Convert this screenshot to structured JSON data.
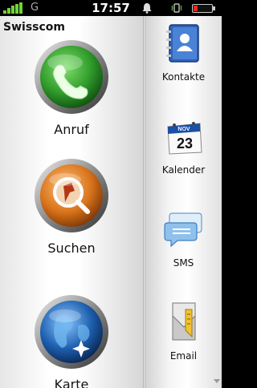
{
  "status_bar": {
    "network_type": "G",
    "time": "17:57"
  },
  "carrier": "Swisscom",
  "main_apps": [
    {
      "label": "Anruf",
      "icon": "phone-icon"
    },
    {
      "label": "Suchen",
      "icon": "search-icon"
    },
    {
      "label": "Karte",
      "icon": "map-globe-icon"
    }
  ],
  "side_apps": [
    {
      "label": "Kontakte",
      "icon": "contacts-book-icon"
    },
    {
      "label": "Kalender",
      "icon": "calendar-icon",
      "month": "NOV",
      "day": "23"
    },
    {
      "label": "SMS",
      "icon": "sms-bubble-icon"
    },
    {
      "label": "Email",
      "icon": "email-envelope-icon"
    }
  ],
  "colors": {
    "signal": "#6fd33a",
    "phone_green": "#2f9a2a",
    "search_orange": "#d8731a",
    "map_blue": "#1d5fae",
    "battery_low": "#e02b20"
  }
}
